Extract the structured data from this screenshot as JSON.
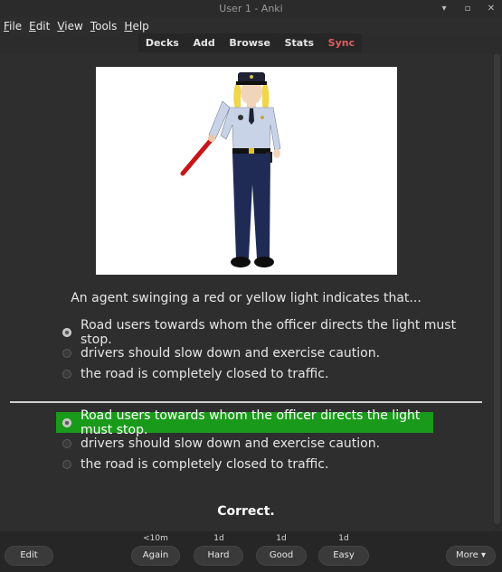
{
  "window": {
    "title": "User 1 - Anki",
    "controls": [
      "▾",
      "▫",
      "✕"
    ]
  },
  "menu": [
    {
      "underline": "F",
      "rest": "ile"
    },
    {
      "underline": "E",
      "rest": "dit"
    },
    {
      "underline": "V",
      "rest": "iew"
    },
    {
      "underline": "T",
      "rest": "ools"
    },
    {
      "underline": "H",
      "rest": "elp"
    }
  ],
  "toolbar": {
    "decks": "Decks",
    "add": "Add",
    "browse": "Browse",
    "stats": "Stats",
    "sync": "Sync",
    "sync_color": "#e25c5c"
  },
  "card": {
    "question": "An agent swinging a red or yellow light indicates that...",
    "options_front": [
      {
        "text": "Road users towards whom the officer directs the light must stop.",
        "selected": true
      },
      {
        "text": "drivers should slow down and exercise caution.",
        "selected": false
      },
      {
        "text": "the road is completely closed to traffic.",
        "selected": false
      }
    ],
    "options_back": [
      {
        "text": "Road users towards whom the officer directs the light must stop.",
        "selected": true,
        "correct": true
      },
      {
        "text": "drivers should slow down and exercise caution.",
        "selected": false
      },
      {
        "text": "the road is completely closed to traffic.",
        "selected": false
      }
    ],
    "correct_color": "#1a9a1a",
    "result": "Correct."
  },
  "answer_bar": {
    "edit": "Edit",
    "again": {
      "label": "Again",
      "interval": "<10m"
    },
    "hard": {
      "label": "Hard",
      "interval": "1d"
    },
    "good": {
      "label": "Good",
      "interval": "1d"
    },
    "easy": {
      "label": "Easy",
      "interval": "1d"
    },
    "more": "More ▾"
  }
}
